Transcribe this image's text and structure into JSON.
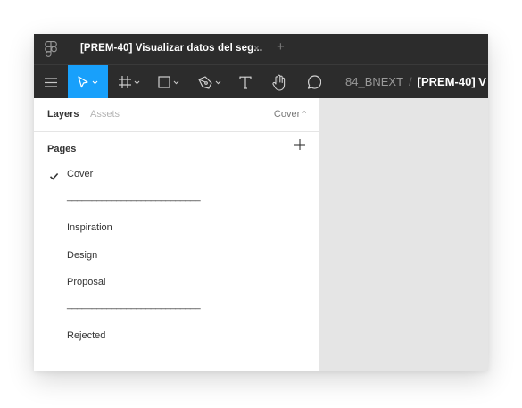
{
  "window": {
    "tab_title": "[PREM-40] Visualizar datos del seg...",
    "tab_close": "×",
    "tab_add": "+"
  },
  "toolbar": {
    "tools": [
      "menu-icon",
      "move-tool-icon",
      "frame-tool-icon",
      "rectangle-tool-icon",
      "pen-tool-icon",
      "text-tool-icon",
      "hand-tool-icon",
      "comment-tool-icon"
    ],
    "active_tool": "move-tool-icon",
    "breadcrumb": {
      "team": "84_BNEXT",
      "separator": "/",
      "file": "[PREM-40] V"
    }
  },
  "panel": {
    "tabs": {
      "layers": "Layers",
      "assets": "Assets"
    },
    "current_page": "Cover",
    "pages_title": "Pages",
    "pages": [
      {
        "label": "Cover",
        "selected": true,
        "divider": false
      },
      {
        "label": "___________________________",
        "selected": false,
        "divider": true
      },
      {
        "label": "Inspiration",
        "selected": false,
        "divider": false
      },
      {
        "label": "Design",
        "selected": false,
        "divider": false
      },
      {
        "label": "Proposal",
        "selected": false,
        "divider": false
      },
      {
        "label": "___________________________",
        "selected": false,
        "divider": true
      },
      {
        "label": "Rejected",
        "selected": false,
        "divider": false
      }
    ]
  },
  "colors": {
    "toolbar_bg": "#2c2c2c",
    "active_tool": "#18a0fb",
    "canvas": "#e5e5e5",
    "panel_bg": "#ffffff"
  }
}
